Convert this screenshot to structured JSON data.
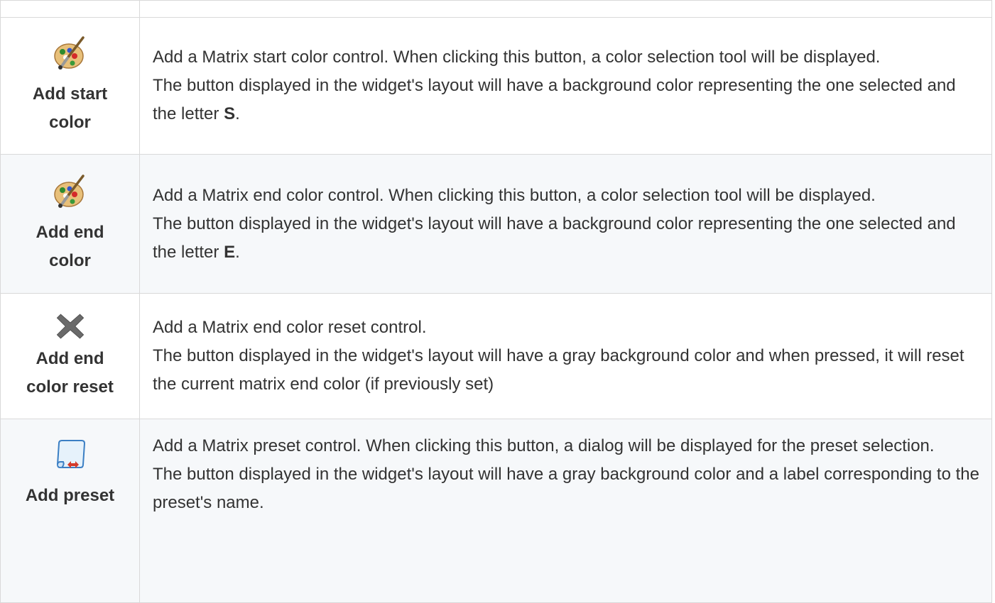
{
  "rows": [
    {
      "icon": "palette-icon",
      "label": "Add start color",
      "desc_line1": "Add a Matrix start color control. When clicking this button, a color selection tool will be displayed.",
      "desc_line2_prefix": "The button displayed in the widget's layout will have a background color representing the one selected and the letter ",
      "desc_line2_bold": "S",
      "desc_line2_suffix": "."
    },
    {
      "icon": "palette-icon",
      "label": "Add end color",
      "desc_line1": "Add a Matrix end color control. When clicking this button, a color selection tool will be displayed.",
      "desc_line2_prefix": "The button displayed in the widget's layout will have a background color representing the one selected and the letter ",
      "desc_line2_bold": "E",
      "desc_line2_suffix": "."
    },
    {
      "icon": "close-x-icon",
      "label": "Add end color reset",
      "desc_line1": "Add a Matrix end color reset control.",
      "desc_line2": "The button displayed in the widget's layout will have a gray background color and when pressed, it will reset the current matrix end color (if previously set)"
    },
    {
      "icon": "scroll-icon",
      "label": "Add preset",
      "desc_line1": "Add a Matrix preset control. When clicking this button, a dialog will be displayed for the preset selection.",
      "desc_line2": "The button displayed in the widget's layout will have a gray background color and a label corresponding to the preset's name."
    }
  ],
  "colors": {
    "border": "#d9d9d9",
    "alt_row": "#f6f8fa",
    "text": "#333333"
  }
}
